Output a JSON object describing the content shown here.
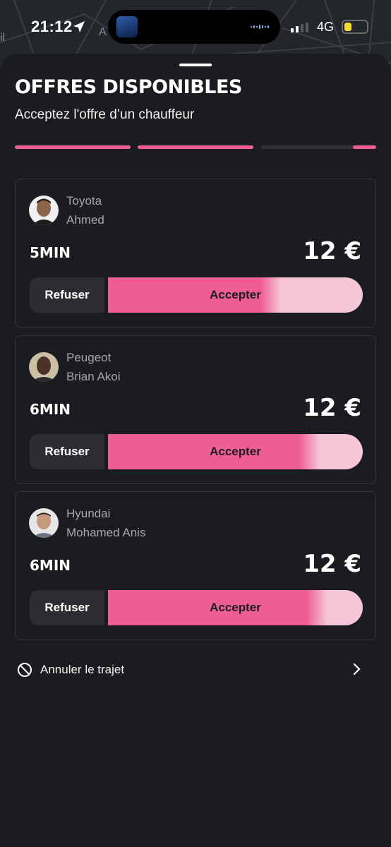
{
  "status_bar": {
    "time": "21:12",
    "network": "4G",
    "map_label": "A"
  },
  "header": {
    "title": "OFFRES DISPONIBLES",
    "subtitle": "Acceptez l'offre d’un chauffeur"
  },
  "progress": {
    "segments": [
      1.0,
      1.0,
      0.2
    ],
    "accent_color": "#ef5e93"
  },
  "offers": [
    {
      "car": "Toyota",
      "driver": "Ahmed",
      "eta": "5MIN",
      "price": "12 €",
      "refuse_label": "Refuser",
      "accept_label": "Accepter",
      "accept_timer_remaining": 0.4
    },
    {
      "car": "Peugeot",
      "driver": "Brian Akoi",
      "eta": "6MIN",
      "price": "12 €",
      "refuse_label": "Refuser",
      "accept_label": "Accepter",
      "accept_timer_remaining": 0.25
    },
    {
      "car": "Hyundai",
      "driver": "Mohamed Anis",
      "eta": "6MIN",
      "price": "12 €",
      "refuse_label": "Refuser",
      "accept_label": "Accepter",
      "accept_timer_remaining": 0.22
    }
  ],
  "cancel": {
    "label": "Annuler le trajet",
    "icon": "prohibited-icon",
    "chevron_icon": "chevron-right-icon"
  }
}
